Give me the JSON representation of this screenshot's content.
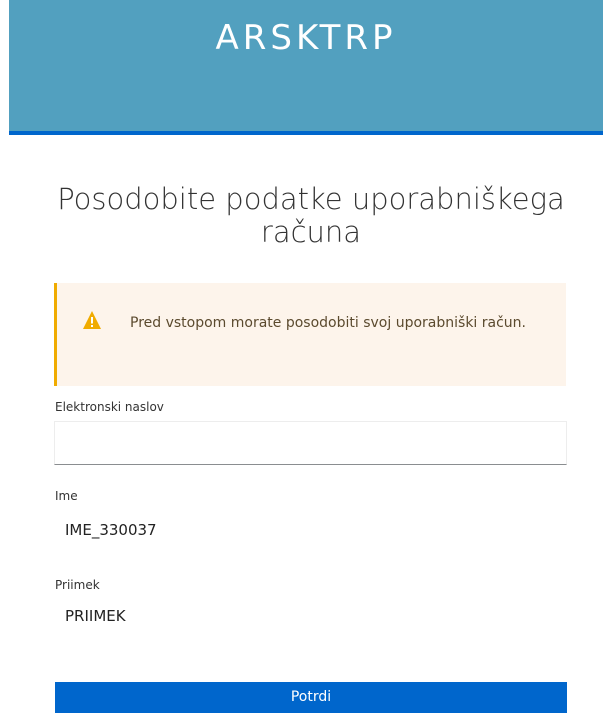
{
  "header": {
    "brand": "ARSKTRP"
  },
  "page": {
    "title": "Posodobite podatke uporabniškega računa"
  },
  "alert": {
    "icon": "warning-icon",
    "message": "Pred vstopom morate posodobiti svoj uporabniški račun."
  },
  "form": {
    "email": {
      "label": "Elektronski naslov",
      "value": "",
      "placeholder": ""
    },
    "first_name": {
      "label": "Ime",
      "value": "IME_330037"
    },
    "last_name": {
      "label": "Priimek",
      "value": "PRIIMEK"
    },
    "submit_label": "Potrdi"
  },
  "colors": {
    "header_bg": "#52a0bf",
    "accent": "#0066cc",
    "warning": "#f0ab00",
    "alert_bg": "#fdf4eb"
  }
}
